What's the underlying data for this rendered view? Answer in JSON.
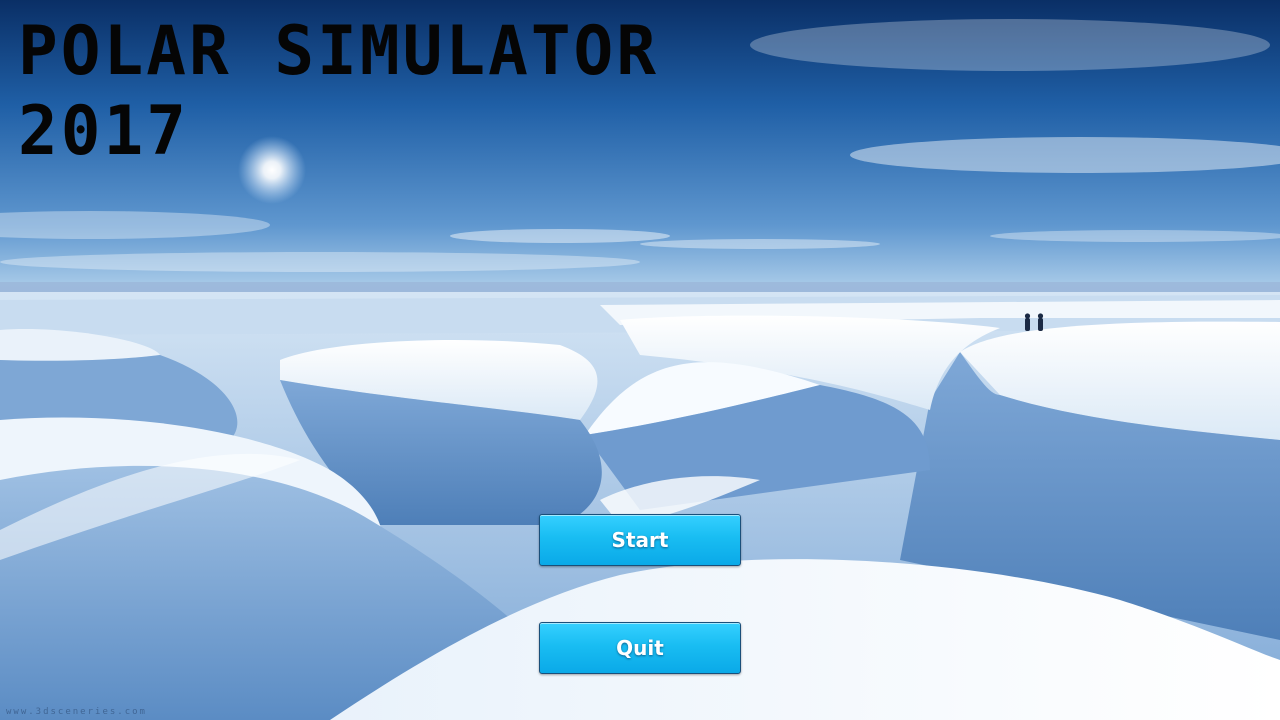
{
  "game": {
    "title_line_1": "POLAR SIMULATOR",
    "title_line_2": "2017"
  },
  "menu": {
    "start_label": "Start",
    "quit_label": "Quit"
  },
  "watermark": "www.3dsceneries.com",
  "colors": {
    "sky_top": "#0b356f",
    "sky_horizon": "#a9cbe8",
    "snow_light": "#f4f8fc",
    "snow_shadow": "#5f8fc4",
    "button_fill": "#19bdf2",
    "title_text": "#050505"
  }
}
